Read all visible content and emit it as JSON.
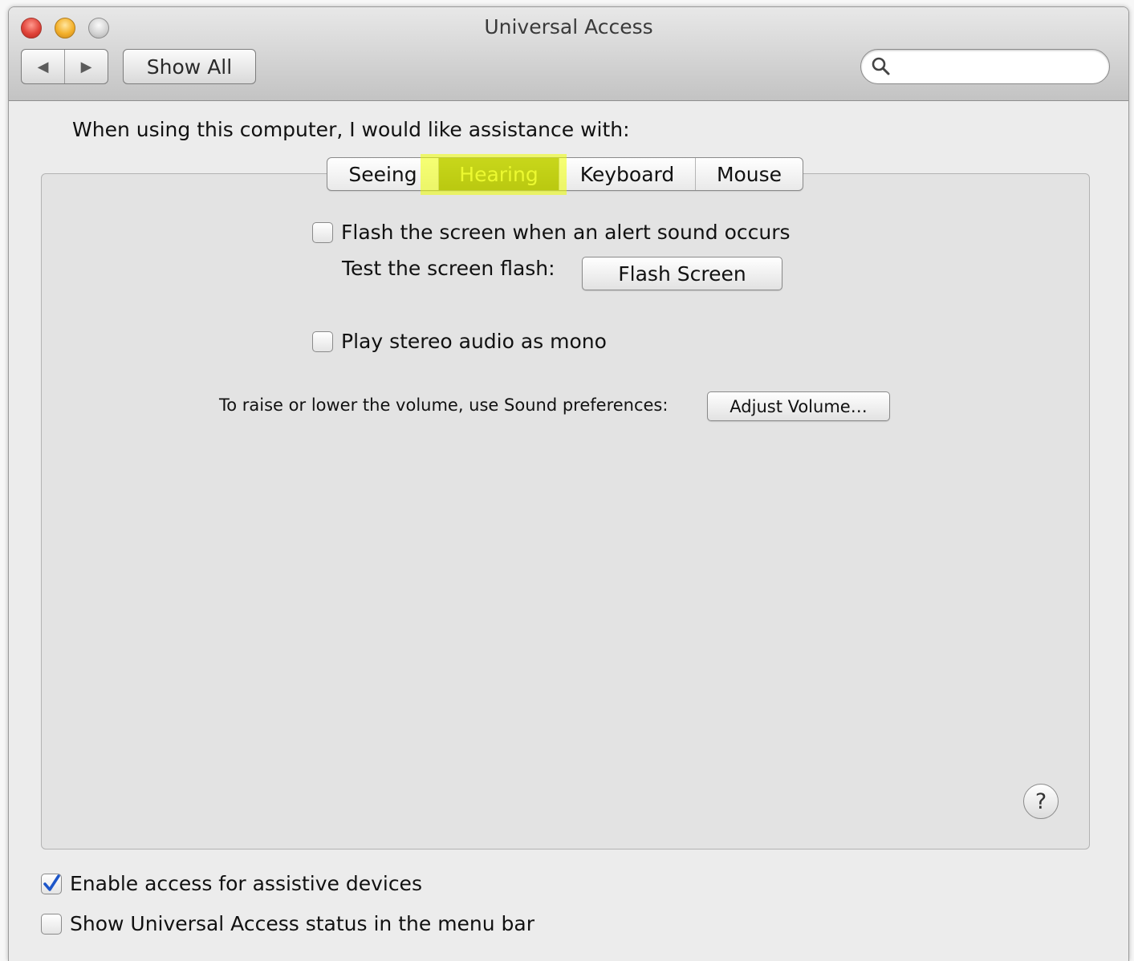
{
  "window": {
    "title": "Universal Access"
  },
  "toolbar": {
    "back_icon": "◀",
    "forward_icon": "▶",
    "show_all_label": "Show All",
    "search_value": "",
    "search_placeholder": ""
  },
  "prompt": "When using this computer, I would like assistance with:",
  "tabs": [
    {
      "label": "Seeing",
      "selected": false
    },
    {
      "label": "Hearing",
      "selected": true
    },
    {
      "label": "Keyboard",
      "selected": false
    },
    {
      "label": "Mouse",
      "selected": false
    }
  ],
  "hearing": {
    "flash_checkbox_label": "Flash the screen when an alert sound occurs",
    "flash_checked": false,
    "test_flash_label": "Test the screen flash:",
    "flash_button_label": "Flash Screen",
    "mono_checkbox_label": "Play stereo audio as mono",
    "mono_checked": false,
    "volume_label": "To raise or lower the volume, use Sound preferences:",
    "adjust_volume_label": "Adjust Volume…"
  },
  "help_label": "?",
  "footer": {
    "assistive_label": "Enable access for assistive devices",
    "assistive_checked": true,
    "status_label": "Show Universal Access status in the menu bar",
    "status_checked": false
  },
  "colors": {
    "highlight": "#eeff00",
    "selected_tab": "#7a8724",
    "checkmark": "#1d56c9"
  }
}
